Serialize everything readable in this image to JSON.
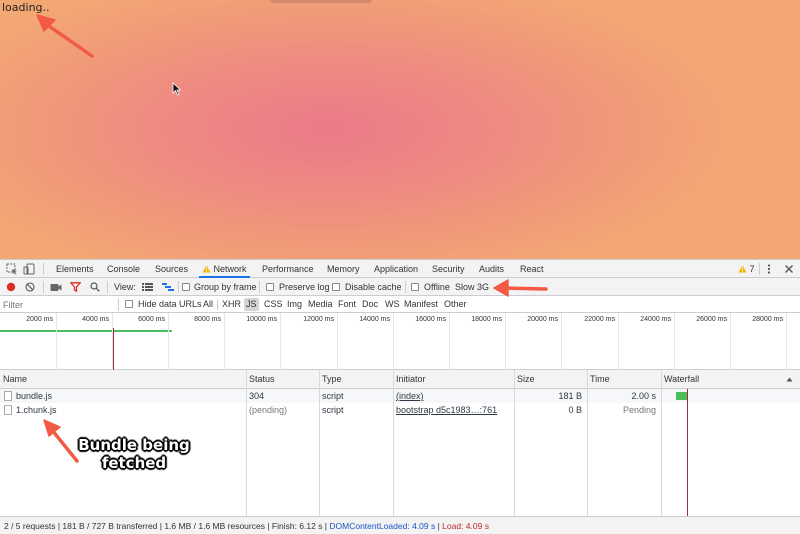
{
  "page": {
    "loading_text": "loading.."
  },
  "devtools": {
    "warning_count": "7",
    "tabs": [
      {
        "label": "Elements"
      },
      {
        "label": "Console"
      },
      {
        "label": "Sources"
      },
      {
        "label": "Network"
      },
      {
        "label": "Performance"
      },
      {
        "label": "Memory"
      },
      {
        "label": "Application"
      },
      {
        "label": "Security"
      },
      {
        "label": "Audits"
      },
      {
        "label": "React"
      }
    ],
    "toolbar": {
      "view_label": "View:",
      "group_by_frame": "Group by frame",
      "preserve_log": "Preserve log",
      "disable_cache": "Disable cache",
      "offline": "Offline",
      "throttle": "Slow 3G"
    },
    "filterbar": {
      "filter_placeholder": "Filter",
      "hide_data_urls": "Hide data URLs",
      "types": [
        "All",
        "XHR",
        "JS",
        "CSS",
        "Img",
        "Media",
        "Font",
        "Doc",
        "WS",
        "Manifest",
        "Other"
      ],
      "selected_type": "JS"
    },
    "overview": {
      "ticks": [
        "2000 ms",
        "4000 ms",
        "6000 ms",
        "8000 ms",
        "10000 ms",
        "12000 ms",
        "14000 ms",
        "16000 ms",
        "18000 ms",
        "20000 ms",
        "22000 ms",
        "24000 ms",
        "26000 ms",
        "28000 ms"
      ]
    },
    "table": {
      "headers": {
        "name": "Name",
        "status": "Status",
        "type": "Type",
        "initiator": "Initiator",
        "size": "Size",
        "time": "Time",
        "waterfall": "Waterfall"
      },
      "rows": [
        {
          "name": "bundle.js",
          "status": "304",
          "type": "script",
          "initiator": "(index)",
          "size": "181 B",
          "time": "2.00 s"
        },
        {
          "name": "1.chunk.js",
          "status": "(pending)",
          "type": "script",
          "initiator": "bootstrap d5c1983…:761",
          "size": "0 B",
          "time": "Pending"
        }
      ]
    },
    "statusbar": {
      "summary": "2 / 5 requests | 181 B / 727 B transferred | 1.6 MB / 1.6 MB resources | Finish: 6.12 s | ",
      "dom_content_loaded": "DOMContentLoaded: 4.09 s",
      "sep": " | ",
      "load": "Load: 4.09 s"
    }
  },
  "annotation": {
    "text": "Bundle being fetched"
  },
  "colors": {
    "accent": "#1a73e8",
    "record": "#d93025",
    "annotation_arrow": "#f25a46",
    "waterfall_bar": "#4bbd5c"
  }
}
